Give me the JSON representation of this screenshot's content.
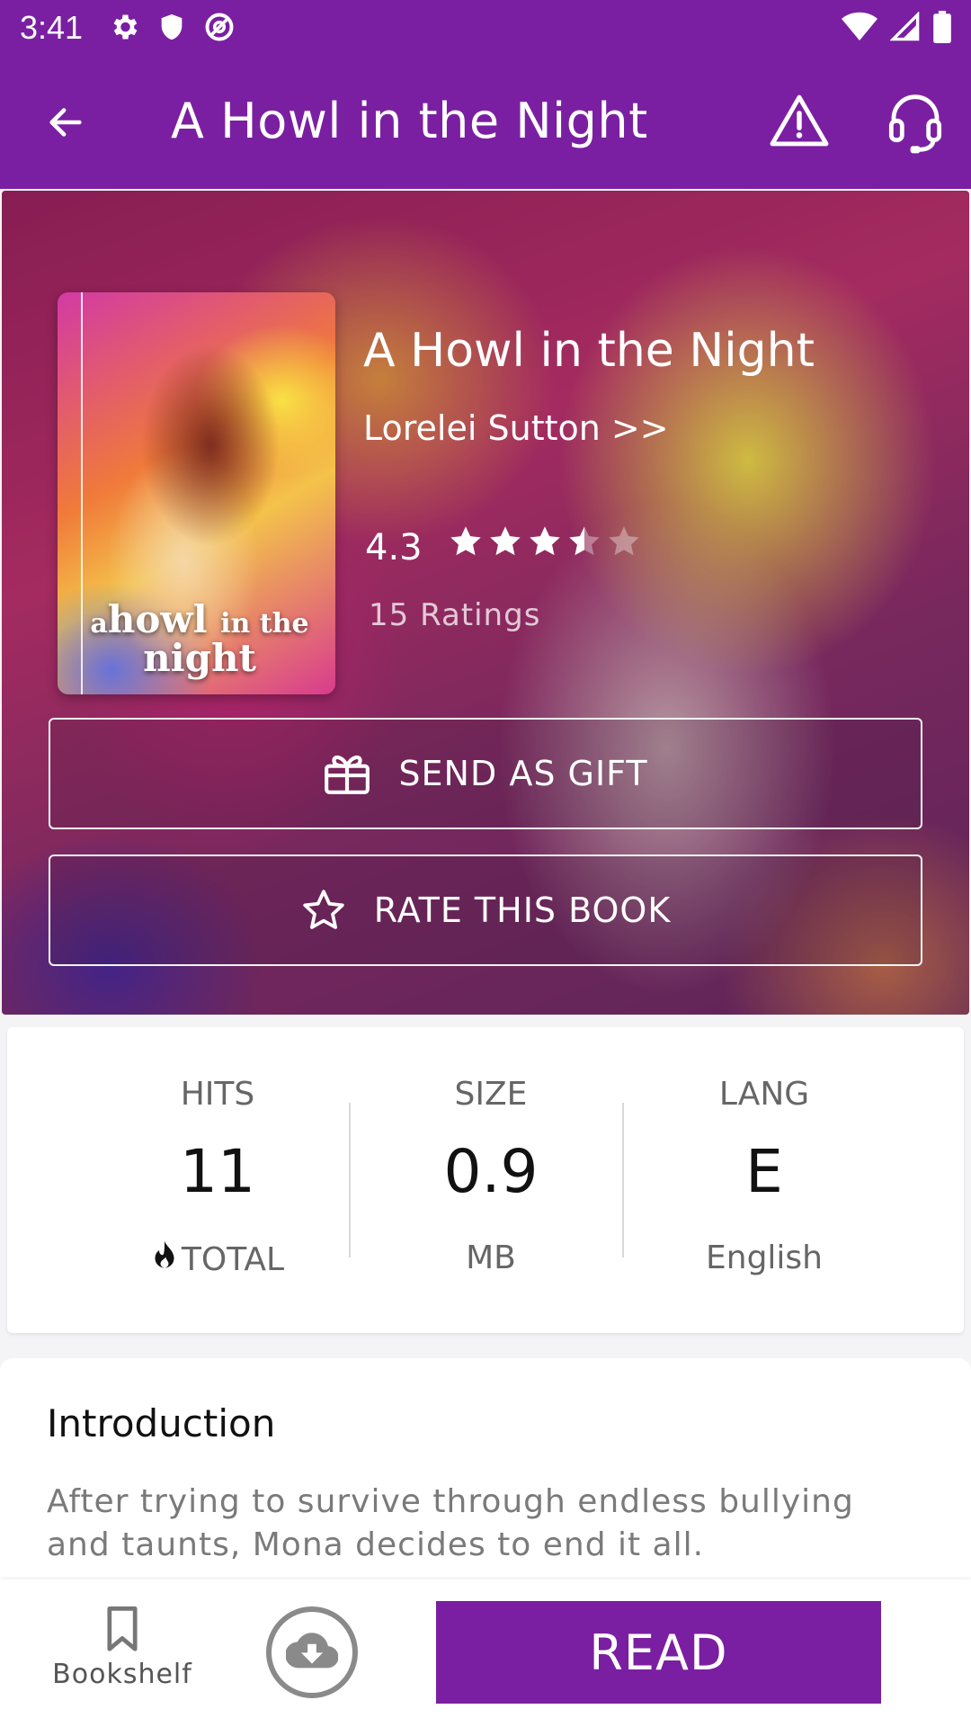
{
  "status_bar": {
    "time": "3:41",
    "left_icons": [
      "settings-icon",
      "shield-icon",
      "at-sign-icon"
    ],
    "right_icons": [
      "wifi-icon",
      "signal-icon",
      "battery-icon"
    ]
  },
  "app_bar": {
    "title": "A Howl in the Night",
    "back_icon": "arrow-left-icon",
    "report_icon": "warning-icon",
    "support_icon": "headset-icon",
    "background": "#7a1fa2"
  },
  "book": {
    "cover_title_small": "a",
    "cover_title_line1": "howl",
    "cover_title_line1_small": "in the",
    "cover_title_line2": "night",
    "title": "A Howl in the Night",
    "author_link": "Lorelei Sutton >>",
    "rating": "4.3",
    "rating_value": 3.5,
    "rating_max": 5,
    "ratings_count": "15 Ratings"
  },
  "actions": {
    "gift_label": "SEND AS GIFT",
    "gift_icon": "gift-icon",
    "rate_label": "RATE THIS BOOK",
    "rate_icon": "star-outline-icon"
  },
  "stats": {
    "hits": {
      "label": "HITS",
      "value": "11",
      "sub": "TOTAL",
      "icon": "flame-icon"
    },
    "size": {
      "label": "SIZE",
      "value": "0.9",
      "sub": "MB"
    },
    "lang": {
      "label": "LANG",
      "value": "E",
      "sub": "English"
    }
  },
  "introduction": {
    "heading": "Introduction",
    "text": "After trying to survive through endless bullying and taunts, Mona decides to end it all."
  },
  "bottom_bar": {
    "bookshelf_label": "Bookshelf",
    "bookshelf_icon": "bookmark-icon",
    "download_icon": "cloud-download-icon",
    "read_label": "READ",
    "accent": "#7a1fa2"
  }
}
